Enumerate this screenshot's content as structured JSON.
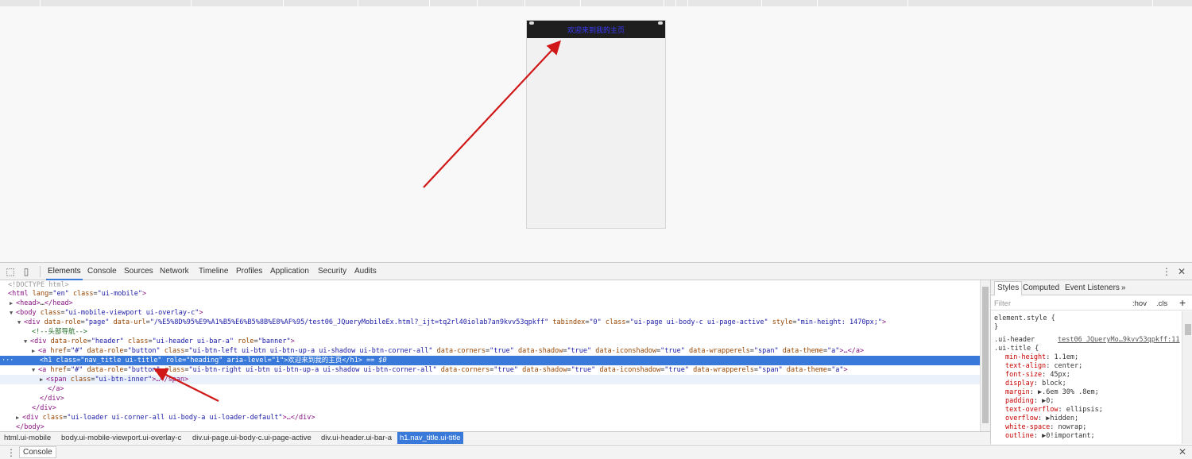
{
  "phone": {
    "title": "欢迎来到我的主页"
  },
  "devtools": {
    "tabs": [
      "Elements",
      "Console",
      "Sources",
      "Network",
      "Timeline",
      "Profiles",
      "Application",
      "Security",
      "Audits"
    ],
    "tools": {
      "inspect": "⬚",
      "device": "▯",
      "more": "⋮",
      "close": "✕"
    },
    "dom": {
      "l0": "<!DOCTYPE html>",
      "l1_tag": "<html",
      "l1_a1": "lang",
      "l1_v1": "\"en\"",
      "l1_a2": "class",
      "l1_v2": "\"ui-mobile\"",
      "l1_end": ">",
      "l2_tag": "<head>",
      "l2_dots": "…",
      "l2_end": "</head>",
      "l3_tag": "<body",
      "l3_a1": "class",
      "l3_v1": "\"ui-mobile-viewport ui-overlay-c\"",
      "l3_end": ">",
      "l4_tag": "<div",
      "l4_a1": "data-role",
      "l4_v1": "\"page\"",
      "l4_a2": "data-url",
      "l4_v2": "\"/%E5%8D%95%E9%A1%B5%E6%B5%8B%E8%AF%95/test06_JQueryMobileEx.html?_ijt=tq2rl40iolab7an9kvv53qpkff\"",
      "l4_a3": "tabindex",
      "l4_v3": "\"0\"",
      "l4_a4": "class",
      "l4_v4": "\"ui-page ui-body-c ui-page-active\"",
      "l4_a5": "style",
      "l4_v5": "\"min-height: 1470px;\"",
      "l4_end": ">",
      "l5": "<!--头部导航-->",
      "l6_tag": "<div",
      "l6_a1": "data-role",
      "l6_v1": "\"header\"",
      "l6_a2": "class",
      "l6_v2": "\"ui-header ui-bar-a\"",
      "l6_a3": "role",
      "l6_v3": "\"banner\"",
      "l6_end": ">",
      "l7_tag": "<a",
      "l7_a1": "href",
      "l7_v1": "\"#\"",
      "l7_a2": "data-role",
      "l7_v2": "\"button\"",
      "l7_a3": "class",
      "l7_v3": "\"ui-btn-left ui-btn ui-btn-up-a ui-shadow ui-btn-corner-all\"",
      "l7_a4": "data-corners",
      "l7_v4": "\"true\"",
      "l7_a5": "data-shadow",
      "l7_v5": "\"true\"",
      "l7_a6": "data-iconshadow",
      "l7_v6": "\"true\"",
      "l7_a7": "data-wrapperels",
      "l7_v7": "\"span\"",
      "l7_a8": "data-theme",
      "l7_v8": "\"a\"",
      "l7_end": ">…</a>",
      "l8_dots": "···",
      "l8_tag": "<h1",
      "l8_a1": "class",
      "l8_v1": "\"nav_title ui-title\"",
      "l8_a2": "role",
      "l8_v2": "\"heading\"",
      "l8_a3": "aria-level",
      "l8_v3": "\"1\"",
      "l8_text": ">欢迎来到我的主页</h1>",
      "l8_eq": " == $0",
      "l9_tag": "<a",
      "l9_a1": "href",
      "l9_v1": "\"#\"",
      "l9_a2": "data-role",
      "l9_v2": "\"button\"",
      "l9_a3": "class",
      "l9_v3": "\"ui-btn-right ui-btn ui-btn-up-a ui-shadow ui-btn-corner-all\"",
      "l9_a4": "data-corners",
      "l9_v4": "\"true\"",
      "l9_a5": "data-shadow",
      "l9_v5": "\"true\"",
      "l9_a6": "data-iconshadow",
      "l9_v6": "\"true\"",
      "l9_a7": "data-wrapperels",
      "l9_v7": "\"span\"",
      "l9_a8": "data-theme",
      "l9_v8": "\"a\"",
      "l9_end": ">",
      "l10_tag": "<span",
      "l10_a1": "class",
      "l10_v1": "\"ui-btn-inner\"",
      "l10_end": ">…</span>",
      "l11": "</a>",
      "l12": "</div>",
      "l13": "</div>",
      "l14_tag": "<div",
      "l14_a1": "class",
      "l14_v1": "\"ui-loader ui-corner-all ui-body-a ui-loader-default\"",
      "l14_end": ">…</div>",
      "l15": "</body>",
      "l16": "</html>"
    },
    "breadcrumbs": [
      "html.ui-mobile",
      "body.ui-mobile-viewport.ui-overlay-c",
      "div.ui-page.ui-body-c.ui-page-active",
      "div.ui-header.ui-bar-a",
      "h1.nav_title.ui-title"
    ],
    "styles": {
      "tabs": [
        "Styles",
        "Computed",
        "Event Listeners",
        "»"
      ],
      "filter_placeholder": "Filter",
      "hov": ":hov",
      "cls": ".cls",
      "plus": "+",
      "element_style": "element.style {",
      "close_brace": "}",
      "sel1": ".ui-header",
      "sel2": ".ui-title {",
      "source": "test06_JQueryMo…9kvv53qpkff:11",
      "props": [
        {
          "name": "min-height",
          "value": "1.1em;"
        },
        {
          "name": "text-align",
          "value": "center;"
        },
        {
          "name": "font-size",
          "value": "45px;"
        },
        {
          "name": "display",
          "value": "block;"
        },
        {
          "name": "margin",
          "value": "▶.6em 30% .8em;"
        },
        {
          "name": "padding",
          "value": "▶0;"
        },
        {
          "name": "text-overflow",
          "value": "ellipsis;"
        },
        {
          "name": "overflow",
          "value": "▶hidden;"
        },
        {
          "name": "white-space",
          "value": "nowrap;"
        },
        {
          "name": "outline",
          "value": "▶0!important;"
        }
      ]
    },
    "drawer": {
      "menu": "⋮",
      "label": "Console",
      "close": "✕"
    }
  },
  "colors": {
    "selection": "#3879d9",
    "arrow": "#d01818",
    "header": "#1e1e1e"
  }
}
